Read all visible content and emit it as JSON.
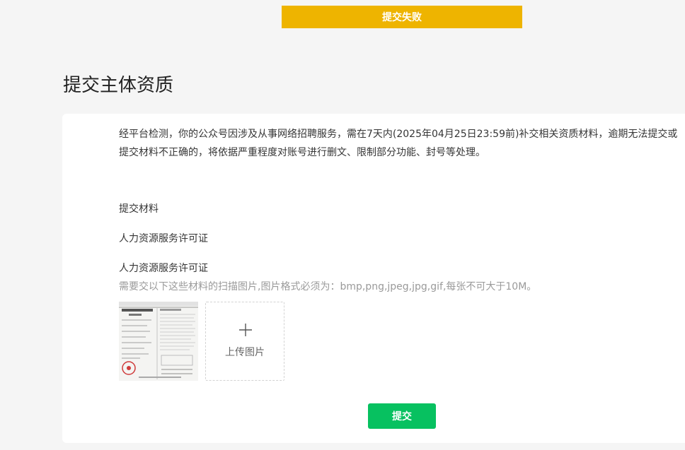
{
  "toast": {
    "message": "提交失败",
    "color": "#eeb400"
  },
  "page": {
    "title": "提交主体资质"
  },
  "card": {
    "notice": "经平台检测，你的公众号因涉及从事网络招聘服务，需在7天内(2025年04月25日23:59前)补交相关资质材料，逾期无法提交或提交材料不正确的，将依据严重程度对账号进行删文、限制部分功能、封号等处理。",
    "materials_label": "提交材料",
    "material_name": "人力资源服务许可证",
    "upload_title": "人力资源服务许可证",
    "upload_hint": "需要交以下这些材料的扫描图片,图片格式必须为：bmp,png,jpeg,jpg,gif,每张不可大于10M。",
    "upload_label": "上传图片",
    "plus_icon": "plus-icon",
    "submit_label": "提交",
    "submit_color": "#07c160"
  }
}
